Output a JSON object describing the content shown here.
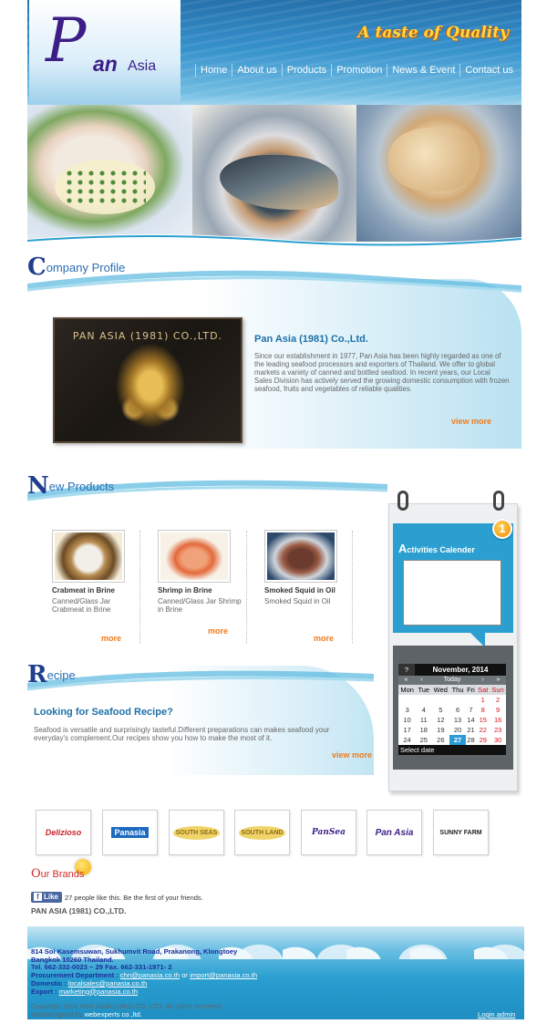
{
  "header": {
    "logo": {
      "p": "P",
      "an": "an",
      "asia": "Asia"
    },
    "tagline": "A taste of Quality",
    "nav": [
      "Home",
      "About us",
      "Products",
      "Promotion",
      "News & Event",
      "Contact us"
    ]
  },
  "profile": {
    "title_cap": "C",
    "title_rest": "ompany Profile",
    "plaque_text": "PAN ASIA (1981) CO.,LTD.",
    "heading": "Pan Asia (1981) Co.,Ltd.",
    "body": "Since our establishment in 1977, Pan Asia has been highly regarded as one of the leading seafood processors and exporters of Thailand. We offer to global markets a variety of canned and bottled seafood. In recent years, our Local Sales Division has actively served the growing domestic consumption with frozen seafood, fruits and vegetables of reliable qualities.",
    "more": "view more"
  },
  "products": {
    "title_cap": "N",
    "title_rest": "ew Products",
    "items": [
      {
        "name": "Crabmeat in Brine",
        "desc": "Canned/Glass Jar Crabmeat in Brine",
        "more": "more"
      },
      {
        "name": "Shrimp in Brine",
        "desc": "Canned/Glass Jar Shrimp in Brine",
        "more": "more"
      },
      {
        "name": "Smoked Squid in Oil",
        "desc": "Smoked Squid in Oil",
        "more": "more"
      }
    ]
  },
  "recipe": {
    "title_cap": "R",
    "title_rest": "ecipe",
    "heading": "Looking for Seafood Recipe?",
    "body": "Seafood is versatile and surprisingly tasteful.Different preparations can makes seafood your everyday's complement.Our recipes show you how to make the most of it.",
    "more": "view more"
  },
  "calendar": {
    "title_cap": "A",
    "title_rest": "ctivities Calender",
    "badge": "1",
    "help": "?",
    "month": "November, 2014",
    "nav_prev_year": "«",
    "nav_prev": "‹",
    "nav_today": "Today",
    "nav_next": "›",
    "nav_next_year": "»",
    "days": [
      "Mon",
      "Tue",
      "Wed",
      "Thu",
      "Fri",
      "Sat",
      "Sun"
    ],
    "weeks": [
      [
        "",
        "",
        "",
        "",
        "",
        "1",
        "2"
      ],
      [
        "3",
        "4",
        "5",
        "6",
        "7",
        "8",
        "9"
      ],
      [
        "10",
        "11",
        "12",
        "13",
        "14",
        "15",
        "16"
      ],
      [
        "17",
        "18",
        "19",
        "20",
        "21",
        "22",
        "23"
      ],
      [
        "24",
        "25",
        "26",
        "27",
        "28",
        "29",
        "30"
      ]
    ],
    "today": "27",
    "footer": "Select date"
  },
  "brands": {
    "logos": [
      "Delizioso",
      "Panasia",
      "SOUTH SEAS",
      "SOUTH LAND",
      "PanSea",
      "Pan Asia",
      "SUNNY FARM"
    ],
    "title_cap": "O",
    "title_rest": "ur Brands"
  },
  "social": {
    "like_label": "Like",
    "like_text": "27 people like this. Be the first of your friends.",
    "company_name": "PAN ASIA (1981) CO.,LTD."
  },
  "footer": {
    "address1": "814 Soi Kasemsuwan, Sukhumvit Road, Prakanong, Klongtoey",
    "address2": "Bangkok 10260 Thailand.",
    "tel": "Tel. 662-332-0023 ~ 29 Fax. 662-331-1971- 2",
    "procurement_label": "Procurement Department :",
    "procurement_email1": "chn@panasia.co.th",
    "procurement_or": "or",
    "procurement_email2": "import@panasia.co.th",
    "domestic_label": "Domestic :",
    "domestic_email": "localsales@panasia.co.th",
    "export_label": "Export :",
    "export_email": "marketing@panasia.co.th",
    "copyright": "Copyright 2008 PAN-ASIA (1981) CO.,LTD. All rights reserved.",
    "designed_by": "Webdesigned by",
    "designer": "webexperts co.,ltd.",
    "login": "Login admin"
  },
  "colors": {
    "accent_blue": "#2a9fd0",
    "title_navy": "#1f3f8c",
    "more_orange": "#f07a1b",
    "brand_purple": "#3c1e86"
  }
}
